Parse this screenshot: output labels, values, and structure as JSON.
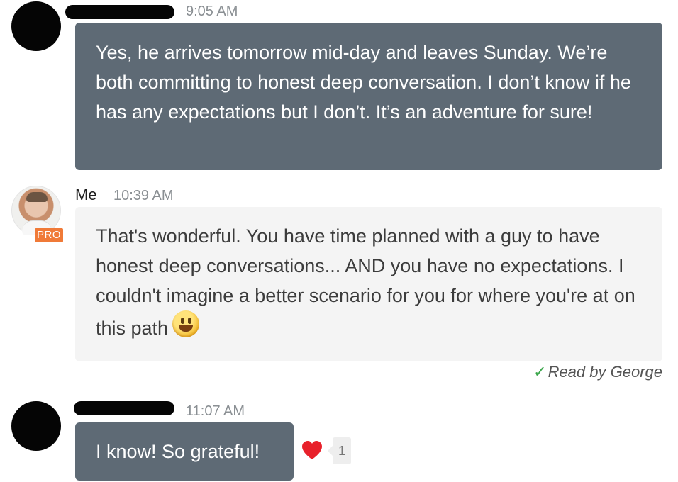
{
  "messages": [
    {
      "sender_redacted": true,
      "time": "9:05 AM",
      "text": "Yes, he arrives tomorrow mid-day and leaves Sunday. We’re both committing to honest deep conversation. I don’t know if he has any expectations but I don’t. It’s an adventure for sure!"
    },
    {
      "sender": "Me",
      "badge": "PRO",
      "time": "10:39 AM",
      "text": "That's wonderful. You have time planned with a guy to have honest deep conversations... AND you have no expectations. I couldn't imagine a better scenario for you for where you're at on this path",
      "emoji": "smiley-emoji",
      "read_receipt": "Read by George"
    },
    {
      "sender_redacted": true,
      "time": "11:07 AM",
      "text": "I know! So grateful!",
      "reaction": {
        "icon": "heart-icon",
        "count": "1",
        "color": "#e8212b"
      }
    }
  ],
  "colors": {
    "dark_bubble": "#5e6a75",
    "light_bubble": "#f4f4f4",
    "pro_badge": "#f07a38",
    "read_check": "#3aa64a"
  }
}
